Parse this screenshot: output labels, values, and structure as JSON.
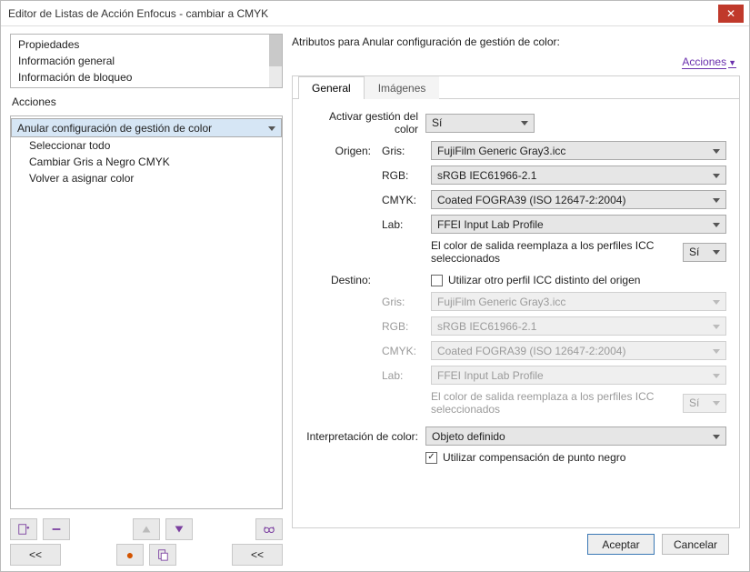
{
  "window": {
    "title": "Editor de Listas de Acción Enfocus - cambiar a CMYK"
  },
  "properties": {
    "items": [
      "Propiedades",
      "Información general",
      "Información de bloqueo"
    ]
  },
  "actions": {
    "label": "Acciones",
    "items": [
      "Anular configuración de gestión de color",
      "Seleccionar todo",
      "Cambiar Gris a Negro CMYK",
      "Volver a asignar color"
    ],
    "selected_index": 0
  },
  "toolbar": {
    "row1": {
      "add": "add",
      "remove": "remove",
      "up": "up",
      "down": "down",
      "view": "view"
    },
    "row2": {
      "undo": "<<",
      "record": "●",
      "paste": "paste",
      "back": "<<"
    }
  },
  "attributes": {
    "title": "Atributos para Anular configuración de gestión de color:",
    "actions_link": "Acciones",
    "tabs": {
      "general": "General",
      "images": "Imágenes"
    },
    "activate_label": "Activar gestión del color",
    "activate_value": "Sí",
    "origin_label": "Origen:",
    "dest_label": "Destino:",
    "rows": {
      "gray_label": "Gris:",
      "rgb_label": "RGB:",
      "cmyk_label": "CMYK:",
      "lab_label": "Lab:"
    },
    "origin": {
      "gray": "FujiFilm Generic Gray3.icc",
      "rgb": "sRGB IEC61966-2.1",
      "cmyk": "Coated FOGRA39 (ISO 12647-2:2004)",
      "lab": "FFEI Input Lab Profile",
      "note": "El color de salida reemplaza a los perfiles ICC seleccionados",
      "note_value": "Sí"
    },
    "dest": {
      "other_icc": "Utilizar otro perfil ICC distinto del origen",
      "gray": "FujiFilm Generic Gray3.icc",
      "rgb": "sRGB IEC61966-2.1",
      "cmyk": "Coated FOGRA39 (ISO 12647-2:2004)",
      "lab": "FFEI Input Lab Profile",
      "note": "El color de salida reemplaza a los perfiles ICC seleccionados",
      "note_value": "Sí"
    },
    "interp_label": "Interpretación de color:",
    "interp_value": "Objeto definido",
    "blackpoint": "Utilizar compensación de punto negro"
  },
  "footer": {
    "ok": "Aceptar",
    "cancel": "Cancelar"
  }
}
